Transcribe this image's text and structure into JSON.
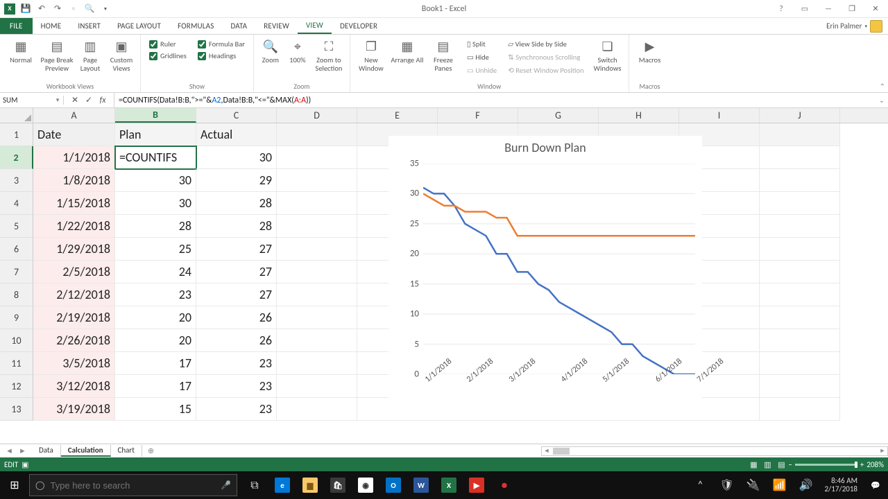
{
  "window": {
    "title": "Book1 - Excel",
    "user": "Erin Palmer"
  },
  "qat": [
    "excel",
    "save",
    "undo",
    "redo",
    "new",
    "preview",
    "customize"
  ],
  "tabs": {
    "file": "FILE",
    "items": [
      "HOME",
      "INSERT",
      "PAGE LAYOUT",
      "FORMULAS",
      "DATA",
      "REVIEW",
      "VIEW",
      "DEVELOPER"
    ],
    "active": "VIEW"
  },
  "ribbon": {
    "workbook_views": {
      "label": "Workbook Views",
      "normal": "Normal",
      "page_break": "Page Break Preview",
      "page_layout": "Page Layout",
      "custom_views": "Custom Views"
    },
    "show": {
      "label": "Show",
      "ruler": "Ruler",
      "formula_bar": "Formula Bar",
      "gridlines": "Gridlines",
      "headings": "Headings"
    },
    "zoom": {
      "label": "Zoom",
      "zoom": "Zoom",
      "pct": "100%",
      "to_selection": "Zoom to Selection"
    },
    "window": {
      "label": "Window",
      "new": "New Window",
      "arrange": "Arrange All",
      "freeze": "Freeze Panes",
      "split": "Split",
      "hide": "Hide",
      "unhide": "Unhide",
      "side": "View Side by Side",
      "sync": "Synchronous Scrolling",
      "reset": "Reset Window Position",
      "switch": "Switch Windows"
    },
    "macros": {
      "label": "Macros",
      "btn": "Macros"
    }
  },
  "formula_bar": {
    "name": "SUM",
    "fx_raw": "=COUNTIFS(Data!B:B,\">=\"&A2,Data!B:B,\"<=\"&MAX(A:A))",
    "p1": "=COUNTIFS(Data!B:B,\">=\"&",
    "ref1": "A2",
    "p2": ",Data!B:B,\"<=\"&MAX(",
    "ref2": "A:A",
    "p3": "))"
  },
  "columns": [
    "A",
    "B",
    "C",
    "D",
    "E",
    "F",
    "G",
    "H",
    "I",
    "J"
  ],
  "grid": {
    "headers": {
      "A": "Date",
      "B": "Plan",
      "C": "Actual"
    },
    "rows": [
      {
        "n": 1
      },
      {
        "n": 2,
        "A": "1/1/2018",
        "B": "=COUNTIFS",
        "C": 30
      },
      {
        "n": 3,
        "A": "1/8/2018",
        "B": 30,
        "C": 29
      },
      {
        "n": 4,
        "A": "1/15/2018",
        "B": 30,
        "C": 28
      },
      {
        "n": 5,
        "A": "1/22/2018",
        "B": 28,
        "C": 28
      },
      {
        "n": 6,
        "A": "1/29/2018",
        "B": 25,
        "C": 27
      },
      {
        "n": 7,
        "A": "2/5/2018",
        "B": 24,
        "C": 27
      },
      {
        "n": 8,
        "A": "2/12/2018",
        "B": 23,
        "C": 27
      },
      {
        "n": 9,
        "A": "2/19/2018",
        "B": 20,
        "C": 26
      },
      {
        "n": 10,
        "A": "2/26/2018",
        "B": 20,
        "C": 26
      },
      {
        "n": 11,
        "A": "3/5/2018",
        "B": 17,
        "C": 23
      },
      {
        "n": 12,
        "A": "3/12/2018",
        "B": 17,
        "C": 23
      },
      {
        "n": 13,
        "A": "3/19/2018",
        "B": 15,
        "C": 23
      }
    ],
    "active_cell": "B2"
  },
  "chart_data": {
    "type": "line",
    "title": "Burn Down Plan",
    "ylim": [
      0,
      35
    ],
    "yticks": [
      0,
      5,
      10,
      15,
      20,
      25,
      30,
      35
    ],
    "xticks": [
      "1/1/2018",
      "2/1/2018",
      "3/1/2018",
      "4/1/2018",
      "5/1/2018",
      "6/1/2018",
      "7/1/2018"
    ],
    "xtick_idx": [
      0,
      4,
      8,
      13,
      17,
      22,
      26
    ],
    "x": [
      "1/1/2018",
      "1/8/2018",
      "1/15/2018",
      "1/22/2018",
      "1/29/2018",
      "2/5/2018",
      "2/12/2018",
      "2/19/2018",
      "2/26/2018",
      "3/5/2018",
      "3/12/2018",
      "3/19/2018",
      "3/26/2018",
      "4/2/2018",
      "4/9/2018",
      "4/16/2018",
      "4/23/2018",
      "4/30/2018",
      "5/7/2018",
      "5/14/2018",
      "5/21/2018",
      "5/28/2018",
      "6/4/2018",
      "6/11/2018",
      "6/18/2018",
      "6/25/2018",
      "7/2/2018"
    ],
    "series": [
      {
        "name": "Plan",
        "color": "#4472c4",
        "values": [
          31,
          30,
          30,
          28,
          25,
          24,
          23,
          20,
          20,
          17,
          17,
          15,
          14,
          12,
          11,
          10,
          9,
          8,
          7,
          5,
          5,
          3,
          2,
          1,
          0,
          0,
          0
        ]
      },
      {
        "name": "Actual",
        "color": "#ed7d31",
        "values": [
          30,
          29,
          28,
          28,
          27,
          27,
          27,
          26,
          26,
          23,
          23,
          23,
          23,
          23,
          23,
          23,
          23,
          23,
          23,
          23,
          23,
          23,
          23,
          23,
          23,
          23,
          23
        ]
      }
    ]
  },
  "sheet_tabs": {
    "items": [
      "Data",
      "Calculation",
      "Chart"
    ],
    "active": "Calculation"
  },
  "status": {
    "mode": "EDIT",
    "zoom": "208%"
  },
  "taskbar": {
    "search_placeholder": "Type here to search",
    "time": "8:46 AM",
    "date": "2/17/2018"
  }
}
